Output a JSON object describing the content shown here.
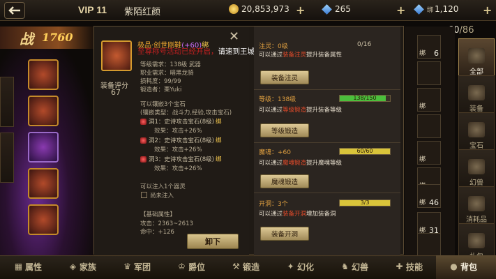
{
  "topbar": {
    "vip": "VIP 11",
    "player_name": "紫陌红颜",
    "gold": "20,853,973",
    "diamond": "265",
    "bound_diamond_prefix": "绑",
    "bound_diamond": "1,120"
  },
  "power": {
    "char": "战",
    "value": "1760"
  },
  "bag": {
    "current": "60",
    "max": "/86"
  },
  "item": {
    "name": "极品·创世刚鞋",
    "enhance": "(+60)",
    "bind": "绑",
    "score_label": "装备评分",
    "score": "67",
    "scroll_notice_red": "至尊称号活动已经开启，",
    "scroll_notice_white": "请速到王城市场区报名参加公会王者称号！",
    "attrs": [
      "等级需求：138级    武器",
      "职业需求：暗黑龙骑",
      "损耗度：99/99",
      "锻造者：栗Yuki"
    ],
    "gem_intro": "可以镶嵌3个宝石",
    "gem_types": "(镶嵌类型：战斗力,经验,攻击宝石)",
    "gems": [
      {
        "label": "洞1：史诗攻击宝石(8级)",
        "bind": "绑",
        "effect": "效果：攻击+26%"
      },
      {
        "label": "洞2：史诗攻击宝石(8级)",
        "bind": "绑",
        "effect": "效果：攻击+26%"
      },
      {
        "label": "洞3：史诗攻击宝石(8级)",
        "bind": "绑",
        "effect": "效果：攻击+26%"
      }
    ],
    "spirit_intro": "可以注入1个器灵",
    "spirit_status": "尚未注入",
    "base_title": "【基础属性】",
    "attack": "攻击：2363~2613",
    "hit": "命中：+126"
  },
  "actions": {
    "spirit": {
      "title": "注灵：0级",
      "progress_text": "0/16",
      "desc_pre": "可以通过",
      "desc_hl": "装备注灵",
      "desc_post": "提升装备属性",
      "button": "装备注灵"
    },
    "level": {
      "title": "等级：138级",
      "progress_text": "138/150",
      "progress": 0.92,
      "color": "#4bbf3c",
      "desc_pre": "可以通过",
      "desc_hl": "等级锻造",
      "desc_post": "提升装备等级",
      "button": "等级锻造"
    },
    "soul": {
      "title": "魔魂：+60",
      "progress_text": "60/60",
      "progress": 1.0,
      "color": "#d9c43a",
      "desc_pre": "可以通过",
      "desc_hl": "魔魂锻造",
      "desc_post": "提升魔魂等级",
      "button": "魔魂锻造"
    },
    "socket": {
      "title": "开洞：3个",
      "progress_text": "3/3",
      "progress": 1.0,
      "color": "#d9c43a",
      "desc_pre": "可以通过",
      "desc_hl": "装备开洞",
      "desc_post": "增加装备洞",
      "button": "装备开洞"
    }
  },
  "dialog": {
    "close": "✕",
    "unload_button": "卸下"
  },
  "inventory": {
    "cells": [
      {
        "bind": "绑",
        "count": "6"
      },
      {
        "bind": "",
        "count": ""
      },
      {
        "bind": "绑",
        "count": ""
      },
      {
        "bind": "",
        "count": ""
      },
      {
        "bind": "绑",
        "count": ""
      },
      {
        "bind": "绑",
        "count": ""
      },
      {
        "bind": "绑",
        "count": "46"
      },
      {
        "bind": "绑",
        "count": "31"
      },
      {
        "bind": "",
        "count": ""
      }
    ]
  },
  "categories": [
    {
      "label": "全部",
      "icon": "chest-icon",
      "active": true
    },
    {
      "label": "装备",
      "icon": "sword-icon",
      "active": false
    },
    {
      "label": "宝石",
      "icon": "gem-icon",
      "active": false
    },
    {
      "label": "幻兽",
      "icon": "beast-icon",
      "active": false
    },
    {
      "label": "消耗品",
      "icon": "potion-icon",
      "active": false
    },
    {
      "label": "礼包",
      "icon": "giftbag-icon",
      "active": false
    }
  ],
  "nav": [
    {
      "label": "属性",
      "icon": "attributes-icon"
    },
    {
      "label": "家族",
      "icon": "family-icon"
    },
    {
      "label": "军团",
      "icon": "legion-icon"
    },
    {
      "label": "爵位",
      "icon": "crown-icon"
    },
    {
      "label": "锻造",
      "icon": "forge-icon"
    },
    {
      "label": "幻化",
      "icon": "transform-icon"
    },
    {
      "label": "幻兽",
      "icon": "beast-icon"
    },
    {
      "label": "技能",
      "icon": "skill-icon"
    },
    {
      "label": "背包",
      "icon": "bag-icon"
    }
  ]
}
